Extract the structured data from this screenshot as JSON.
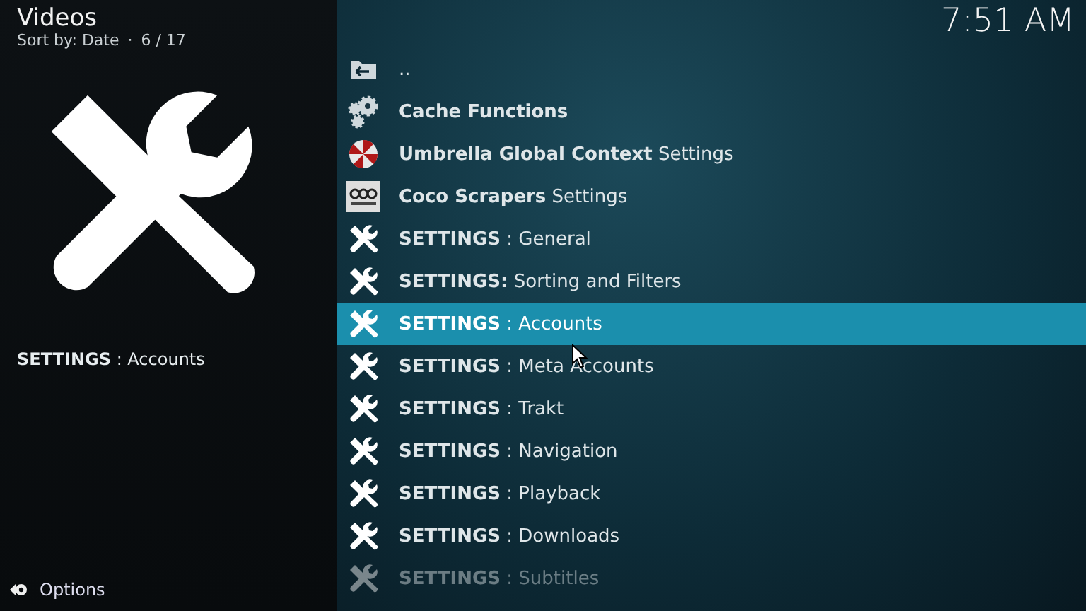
{
  "header": {
    "title": "Videos",
    "sort": "Sort by: Date",
    "separator": "·",
    "position": "6 / 17"
  },
  "clock": "7:51 AM",
  "info": {
    "label": "**SETTINGS** : Accounts"
  },
  "options": "Options",
  "items": [
    {
      "kind": "back",
      "label": "..",
      "selected": false
    },
    {
      "kind": "gears",
      "label": "**Cache Functions**",
      "selected": false
    },
    {
      "kind": "umbrella",
      "label": "**Umbrella Global Context** Settings",
      "selected": false
    },
    {
      "kind": "coco",
      "label": "**Coco Scrapers** Settings",
      "selected": false
    },
    {
      "kind": "tools",
      "label": "**SETTINGS** : General",
      "selected": false
    },
    {
      "kind": "tools",
      "label": "**SETTINGS:** Sorting and Filters",
      "selected": false
    },
    {
      "kind": "tools",
      "label": "**SETTINGS** : Accounts",
      "selected": true
    },
    {
      "kind": "tools",
      "label": "**SETTINGS** : Meta Accounts",
      "selected": false
    },
    {
      "kind": "tools",
      "label": "**SETTINGS** : Trakt",
      "selected": false
    },
    {
      "kind": "tools",
      "label": "**SETTINGS** : Navigation",
      "selected": false
    },
    {
      "kind": "tools",
      "label": "**SETTINGS** : Playback",
      "selected": false
    },
    {
      "kind": "tools",
      "label": "**SETTINGS** : Downloads",
      "selected": false
    },
    {
      "kind": "tools",
      "label": "**SETTINGS** : Subtitles",
      "selected": false
    }
  ]
}
